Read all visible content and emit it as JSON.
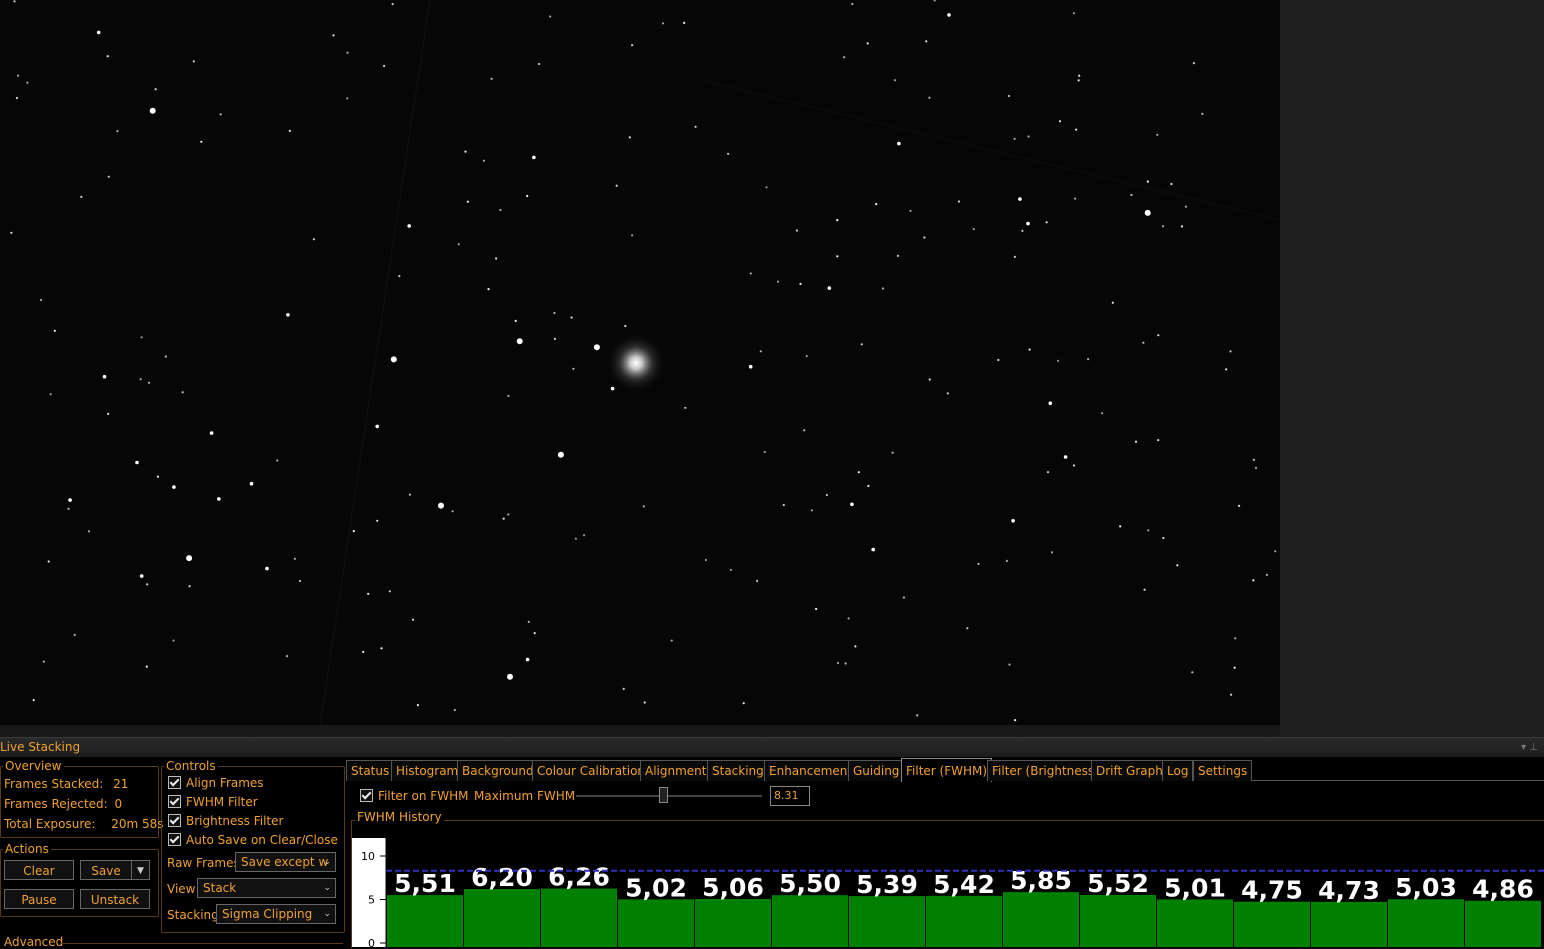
{
  "panel": {
    "title": "Live Stacking"
  },
  "overview": {
    "title": "Overview",
    "frames_stacked_label": "Frames Stacked:",
    "frames_stacked_value": "21",
    "frames_rejected_label": "Frames Rejected:",
    "frames_rejected_value": "0",
    "total_exposure_label": "Total Exposure:",
    "total_exposure_value": "20m 58s"
  },
  "controls": {
    "title": "Controls",
    "align_frames": "Align Frames",
    "fwhm_filter": "FWHM Filter",
    "brightness_filter": "Brightness Filter",
    "auto_save": "Auto Save on Clear/Close",
    "raw_frames_label": "Raw Frames",
    "raw_frames_value": "Save except w",
    "view_label": "View",
    "view_value": "Stack",
    "stacking_label": "Stacking",
    "stacking_value": "Sigma Clipping"
  },
  "actions": {
    "title": "Actions",
    "clear": "Clear",
    "save": "Save",
    "pause": "Pause",
    "unstack": "Unstack"
  },
  "advanced": {
    "title": "Advanced"
  },
  "tabs": [
    "Status",
    "Histogram",
    "Background",
    "Colour Calibration",
    "Alignment",
    "Stacking",
    "Enhancement",
    "Guiding",
    "Filter (FWHM)",
    "Filter (Brightness)",
    "Drift Graph",
    "Log",
    "Settings"
  ],
  "active_tab": "Filter (FWHM)",
  "filter": {
    "filter_on_label": "Filter on FWHM",
    "max_label": "Maximum FWHM",
    "max_value": "8.31",
    "slider_fraction": 0.47
  },
  "chart_data": {
    "type": "bar",
    "title": "FWHM History",
    "values": [
      5.51,
      6.2,
      6.26,
      5.02,
      5.06,
      5.5,
      5.39,
      5.42,
      5.85,
      5.52,
      5.01,
      4.75,
      4.73,
      5.03,
      4.86
    ],
    "labels": [
      "5,51",
      "6,20",
      "6,26",
      "5,02",
      "5,06",
      "5,50",
      "5,39",
      "5,42",
      "5,85",
      "5,52",
      "5,01",
      "4,75",
      "4,73",
      "5,03",
      "4,86"
    ],
    "threshold": 8.31,
    "y_ticks": [
      "10",
      "5",
      "0"
    ],
    "ylim": [
      0,
      12
    ],
    "bar_color": "#008000",
    "threshold_color": "#3030c0"
  }
}
